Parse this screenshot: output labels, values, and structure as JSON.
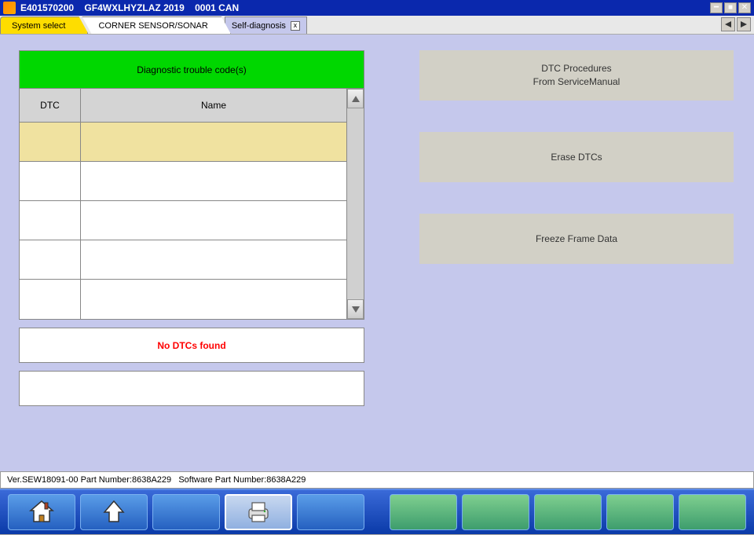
{
  "titlebar": {
    "code": "E401570200",
    "vin": "GF4WXLHYZLAZ 2019",
    "conn": "0001 CAN"
  },
  "tabs": {
    "system_select": "System select",
    "corner_sensor": "CORNER SENSOR/SONAR",
    "self_diag": "Self-diagnosis"
  },
  "dtc": {
    "header": "Diagnostic trouble code(s)",
    "col_dtc": "DTC",
    "col_name": "Name"
  },
  "messages": {
    "no_dtcs": "No DTCs found"
  },
  "actions": {
    "procedures_l1": "DTC Procedures",
    "procedures_l2": "From ServiceManual",
    "erase": "Erase DTCs",
    "freeze": "Freeze Frame Data"
  },
  "status": {
    "ver": "Ver.SEW18091-00",
    "pn": "Part Number:8638A229",
    "spn": "Software Part Number:8638A229"
  }
}
